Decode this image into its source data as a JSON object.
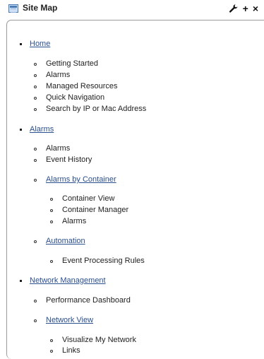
{
  "window": {
    "title": "Site Map"
  },
  "controls": {
    "wrench_icon": "wrench-icon",
    "add_label": "+",
    "close_label": "×"
  },
  "sitemap": {
    "home": "Home",
    "home_items": [
      "Getting Started",
      "Alarms",
      "Managed Resources",
      "Quick Navigation",
      "Search by IP or Mac Address"
    ],
    "alarms": "Alarms",
    "alarms_items": [
      "Alarms",
      "Event History"
    ],
    "alarms_by_container": "Alarms by Container",
    "container_items": [
      "Container View",
      "Container Manager",
      "Alarms"
    ],
    "automation": "Automation",
    "automation_items": [
      "Event Processing Rules"
    ],
    "network_management": "Network Management",
    "network_items": [
      "Performance Dashboard"
    ],
    "network_view": "Network View",
    "network_view_items": [
      "Visualize My Network",
      "Links"
    ]
  },
  "colors": {
    "link": "#2a4f8f",
    "border": "#9a9a9a"
  }
}
